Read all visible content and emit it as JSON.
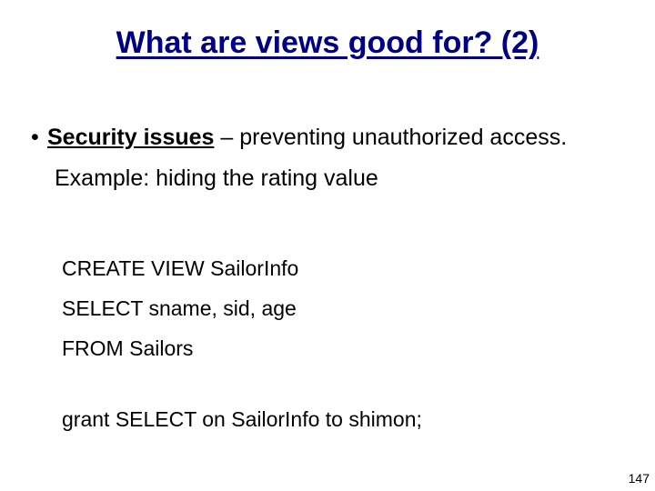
{
  "title": "What are views good for? (2)",
  "bullet": {
    "label_bold": "Security issues",
    "label_rest": " – preventing unauthorized access."
  },
  "example": "Example: hiding the rating value",
  "code": {
    "line1": "CREATE VIEW SailorInfo",
    "line2": "SELECT sname, sid, age",
    "line3": "FROM Sailors",
    "line4": "grant SELECT on SailorInfo to shimon;"
  },
  "page_number": "147"
}
